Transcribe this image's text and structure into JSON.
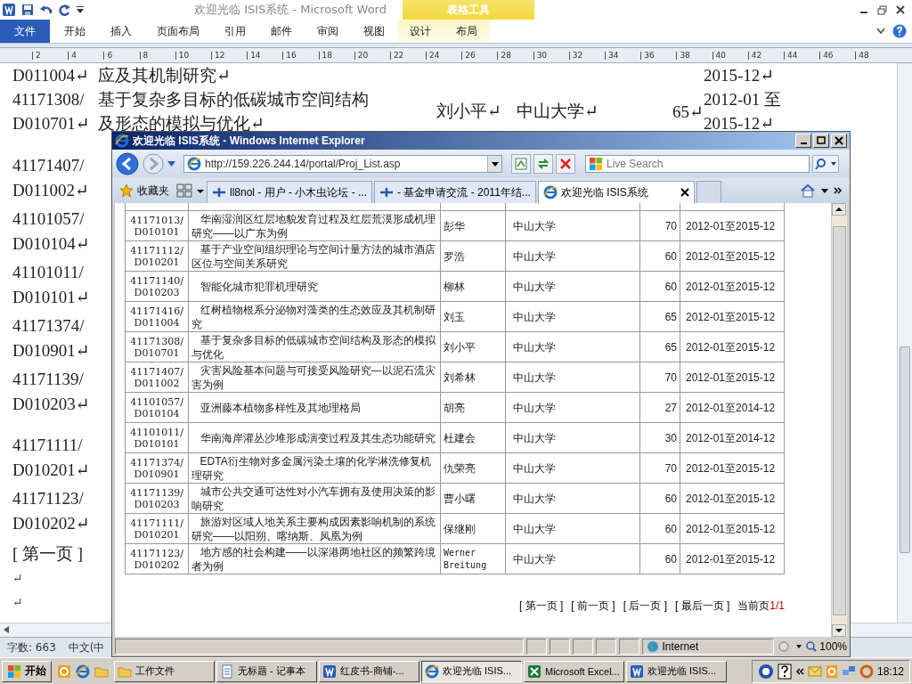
{
  "word": {
    "title": "欢迎光临 ISIS系统  -  Microsoft Word",
    "context_group": "表格工具",
    "ribbon_tabs": [
      {
        "label": "文件",
        "selected": true,
        "contextual": false
      },
      {
        "label": "开始",
        "selected": false,
        "contextual": false
      },
      {
        "label": "插入",
        "selected": false,
        "contextual": false
      },
      {
        "label": "页面布局",
        "selected": false,
        "contextual": false
      },
      {
        "label": "引用",
        "selected": false,
        "contextual": false
      },
      {
        "label": "邮件",
        "selected": false,
        "contextual": false
      },
      {
        "label": "审阅",
        "selected": false,
        "contextual": false
      },
      {
        "label": "视图",
        "selected": false,
        "contextual": false
      },
      {
        "label": "设计",
        "selected": false,
        "contextual": true
      },
      {
        "label": "布局",
        "selected": false,
        "contextual": true
      }
    ],
    "ruler_marks": [
      "2",
      "4",
      "6",
      "8",
      "10",
      "12",
      "14",
      "16",
      "18",
      "20",
      "22",
      "24",
      "26",
      "28",
      "30",
      "32",
      "34",
      "36",
      "38",
      "40",
      "42",
      "44",
      "46",
      "48"
    ],
    "top_records": [
      {
        "id_lines": [
          "D011004↵"
        ],
        "title_lines": [
          "应及其机制研究↵"
        ],
        "period_lines": [
          "2015-12↵"
        ]
      },
      {
        "id_lines": [
          "41171308/",
          "D010701↵"
        ],
        "title_lines": [
          "基于复杂多目标的低碳城市空间结构",
          "及形态的模拟与优化↵"
        ],
        "name": "刘小平↵",
        "unit": "中山大学↵",
        "score": "65↵",
        "period_lines": [
          "2012-01 至",
          "2015-12↵"
        ]
      }
    ],
    "left_entries": [
      {
        "lines": [
          "41171407/",
          "D011002↵"
        ]
      },
      {
        "lines": [
          "41101057/",
          "D010104↵"
        ]
      },
      {
        "lines": [
          "41101011/",
          "D010101↵"
        ]
      },
      {
        "lines": [
          "41171374/",
          "D010901↵"
        ]
      },
      {
        "lines": [
          "41171139/",
          "D010203↵"
        ]
      },
      {
        "lines": [
          "41171111/",
          "D010201↵"
        ]
      },
      {
        "lines": [
          "41171123/",
          "D010202↵"
        ]
      }
    ],
    "page_link": "[ 第一页 ]",
    "trailing_marks": [
      "↵",
      "↵"
    ],
    "status_bar": {
      "word_count": "字数: 663",
      "language": "中文(中"
    }
  },
  "ie": {
    "title": "欢迎光临 ISIS系统 - Windows Internet Explorer",
    "address": "http://159.226.244.14/portal/Proj_List.asp",
    "search": {
      "placeholder": "Live Search"
    },
    "favorites": "收藏夹",
    "tabs": [
      {
        "label": "ll8nol - 用户 - 小木虫论坛 - ...",
        "selected": false
      },
      {
        "label": "- 基金申请交流 - 2011年结...",
        "selected": false
      },
      {
        "label": "欢迎光临 ISIS系统",
        "selected": true
      }
    ],
    "table": {
      "rows": [
        {
          "id": [
            "41171013/",
            "D010101"
          ],
          "title": "华南湿润区红层地貌发育过程及红层荒漠形成机理研究——以广东为例",
          "leader": "彭华",
          "unit": "中山大学",
          "score": "70",
          "period": "2012-01至2015-12"
        },
        {
          "id": [
            "41171112/",
            "D010201"
          ],
          "title": "基于产业空间组织理论与空间计量方法的城市酒店区位与空间关系研究",
          "leader": "罗浩",
          "unit": "中山大学",
          "score": "60",
          "period": "2012-01至2015-12"
        },
        {
          "id": [
            "41171140/",
            "D010203"
          ],
          "title": "智能化城市犯罪机理研究",
          "leader": "柳林",
          "unit": "中山大学",
          "score": "60",
          "period": "2012-01至2015-12"
        },
        {
          "id": [
            "41171416/",
            "D011004"
          ],
          "title": "红树植物根系分泌物对藻类的生态效应及其机制研究",
          "leader": "刘玉",
          "unit": "中山大学",
          "score": "65",
          "period": "2012-01至2015-12"
        },
        {
          "id": [
            "41171308/",
            "D010701"
          ],
          "title": "基于复杂多目标的低碳城市空间结构及形态的模拟与优化",
          "leader": "刘小平",
          "unit": "中山大学",
          "score": "65",
          "period": "2012-01至2015-12"
        },
        {
          "id": [
            "41171407/",
            "D011002"
          ],
          "title": "灾害风险基本问题与可接受风险研究—以泥石流灾害为例",
          "leader": "刘希林",
          "unit": "中山大学",
          "score": "70",
          "period": "2012-01至2015-12"
        },
        {
          "id": [
            "41101057/",
            "D010104"
          ],
          "title": "亚洲藤本植物多样性及其地理格局",
          "leader": "胡亮",
          "unit": "中山大学",
          "score": "27",
          "period": "2012-01至2014-12"
        },
        {
          "id": [
            "41101011/",
            "D010101"
          ],
          "title": "华南海岸灌丛沙堆形成演变过程及其生态功能研究",
          "leader": "杜建会",
          "unit": "中山大学",
          "score": "30",
          "period": "2012-01至2014-12"
        },
        {
          "id": [
            "41171374/",
            "D010901"
          ],
          "title": "EDTA衍生物对多金属污染土壤的化学淋洗修复机理研究",
          "leader": "仇荣亮",
          "unit": "中山大学",
          "score": "70",
          "period": "2012-01至2015-12"
        },
        {
          "id": [
            "41171139/",
            "D010203"
          ],
          "title": "城市公共交通可达性对小汽车拥有及使用决策的影响研究",
          "leader": "曹小曙",
          "unit": "中山大学",
          "score": "60",
          "period": "2012-01至2015-12"
        },
        {
          "id": [
            "41171111/",
            "D010201"
          ],
          "title": "旅游对区域人地关系主要构成因素影响机制的系统研究——以阳朔、喀纳斯、凤凰为例",
          "leader": "保继刚",
          "unit": "中山大学",
          "score": "60",
          "period": "2012-01至2015-12"
        },
        {
          "id": [
            "41171123/",
            "D010202"
          ],
          "title": "地方感的社会构建——以深港两地社区的频繁跨境者为例",
          "leader": "Werner Breitung",
          "unit": "中山大学",
          "score": "60",
          "period": "2012-01至2015-12"
        }
      ]
    },
    "pagination": {
      "links": [
        "[ 第一页 ]",
        "[ 前一页 ]",
        "[ 后一页 ]",
        "[ 最后一页 ]"
      ],
      "current_label": "当前页",
      "current_value": "1/1"
    },
    "status_bar": {
      "zone": "Internet",
      "zoom": "100%"
    }
  },
  "taskbar": {
    "start": "开始",
    "items": [
      {
        "label": "工作文件",
        "kind": "folder",
        "selected": false
      },
      {
        "label": "无标题 - 记事本",
        "kind": "notepad",
        "selected": false
      },
      {
        "label": "红皮书-商铺-...",
        "kind": "word",
        "selected": false
      },
      {
        "label": "欢迎光临 ISIS...",
        "kind": "ie",
        "selected": true
      },
      {
        "label": "Microsoft Excel...",
        "kind": "excel",
        "selected": false
      },
      {
        "label": "欢迎光临 ISIS...",
        "kind": "word",
        "selected": false
      }
    ],
    "clock": "18:12"
  }
}
